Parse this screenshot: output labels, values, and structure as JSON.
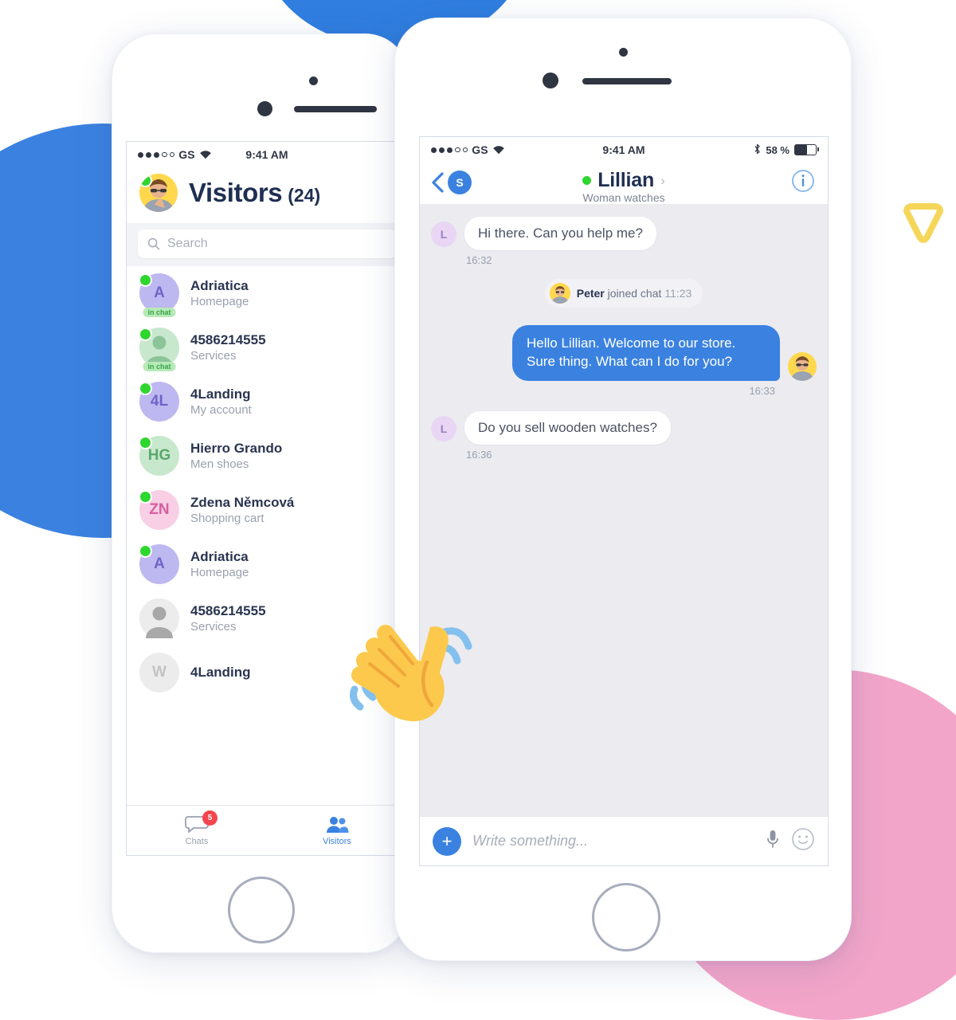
{
  "left_phone": {
    "status_bar": {
      "carrier": "GS",
      "time": "9:41 AM"
    },
    "header": {
      "title": "Visitors",
      "count": "(24)",
      "avatar_name": "peter-avatar"
    },
    "search": {
      "placeholder": "Search",
      "icon": "search-icon"
    },
    "visitors": [
      {
        "initials": "A",
        "name": "Adriatica",
        "page": "Homepage",
        "badge": "in chat",
        "online": true,
        "bg": "#bdb8f0",
        "fg": "#6f64c9",
        "photo": false
      },
      {
        "initials": "",
        "name": "4586214555",
        "page": "Services",
        "badge": "in chat",
        "online": true,
        "bg": "#c8e8ce",
        "fg": "#8cc49a",
        "photo": true
      },
      {
        "initials": "4L",
        "name": "4Landing",
        "page": "My account",
        "badge": "",
        "online": true,
        "bg": "#bdb8f0",
        "fg": "#6f64c9",
        "photo": false
      },
      {
        "initials": "HG",
        "name": "Hierro Grando",
        "page": "Men shoes",
        "badge": "",
        "online": true,
        "bg": "#c8e8ce",
        "fg": "#5aa86c",
        "photo": false
      },
      {
        "initials": "ZN",
        "name": "Zdena Němcová",
        "page": "Shopping cart",
        "badge": "",
        "online": true,
        "bg": "#f8cfe4",
        "fg": "#d65fa0",
        "photo": false
      },
      {
        "initials": "A",
        "name": "Adriatica",
        "page": "Homepage",
        "badge": "",
        "online": true,
        "bg": "#bdb8f0",
        "fg": "#6f64c9",
        "photo": false
      },
      {
        "initials": "",
        "name": "4586214555",
        "page": "Services",
        "badge": "",
        "online": false,
        "bg": "#ececec",
        "fg": "#a8a8a8",
        "photo": true
      },
      {
        "initials": "W",
        "name": "4Landing",
        "page": "",
        "badge": "",
        "online": false,
        "bg": "#ececec",
        "fg": "#c2c2c2",
        "photo": false
      }
    ],
    "tabs": [
      {
        "label": "Chats",
        "icon": "chat-bubble-icon",
        "badge": "5",
        "active": false
      },
      {
        "label": "Visitors",
        "icon": "people-icon",
        "badge": "",
        "active": true
      }
    ]
  },
  "right_phone": {
    "status_bar": {
      "carrier": "GS",
      "time": "9:41 AM",
      "battery": "58 %",
      "bluetooth": "bluetooth-icon"
    },
    "header": {
      "back_icon": "chevron-left-icon",
      "badge_letter": "S",
      "name": "Lillian",
      "chevron": "›",
      "subtitle": "Woman watches",
      "info_icon": "info-circle-icon",
      "online": true
    },
    "messages": [
      {
        "type": "incoming",
        "avatar": "L",
        "text": "Hi there. Can you help me?",
        "time": "16:32"
      },
      {
        "type": "system",
        "name": "Peter",
        "action": "joined chat",
        "time": "11:23"
      },
      {
        "type": "outgoing",
        "text": "Hello Lillian. Welcome to our store. Sure thing. What can I do for you?",
        "time": "16:33"
      },
      {
        "type": "incoming",
        "avatar": "L",
        "text": "Do you sell wooden watches?",
        "time": "16:36"
      }
    ],
    "input": {
      "plus_label": "+",
      "placeholder": "Write something...",
      "mic_icon": "microphone-icon",
      "emoji_icon": "smiley-icon"
    }
  },
  "decor": {
    "wave_emoji": "waving-hand-emoji",
    "colors": {
      "blue": "#3b82e0",
      "pink": "#f2a5c9",
      "yellow": "#f5d658",
      "green": "#2ed62e",
      "red_badge": "#f4454e",
      "chat_bg": "#ebebf0"
    }
  }
}
